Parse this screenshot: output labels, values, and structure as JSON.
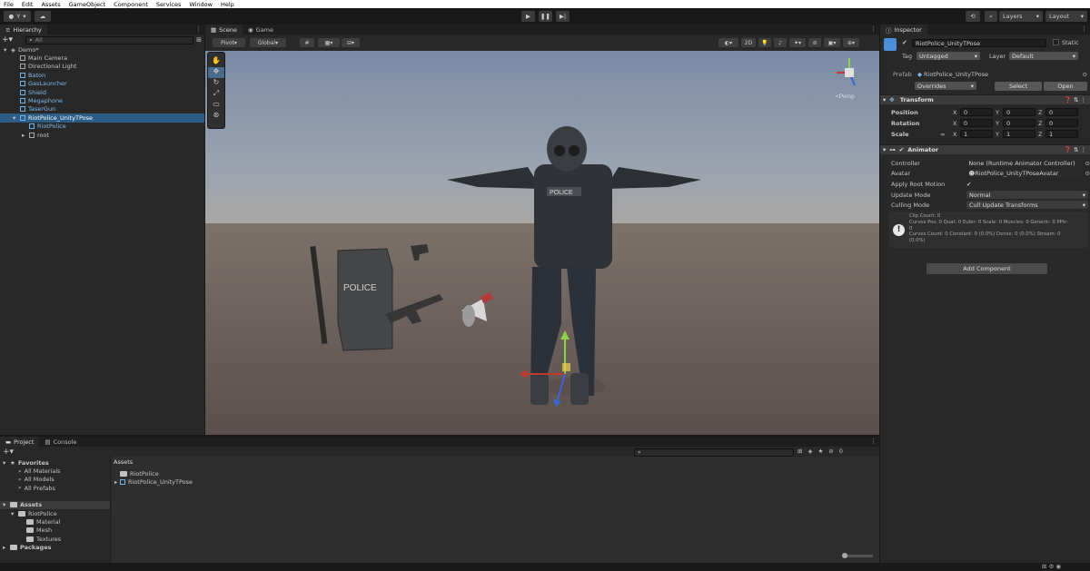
{
  "menu": [
    "File",
    "Edit",
    "Assets",
    "GameObject",
    "Component",
    "Services",
    "Window",
    "Help"
  ],
  "toolbar": {
    "account": "Y",
    "layers": "Layers",
    "layout": "Layout"
  },
  "hierarchy": {
    "tab": "Hierarchy",
    "search_placeholder": "All",
    "items": [
      {
        "label": "Demo*",
        "depth": 0,
        "kind": "scene"
      },
      {
        "label": "Main Camera",
        "depth": 1,
        "kind": "go"
      },
      {
        "label": "Directional Light",
        "depth": 1,
        "kind": "go"
      },
      {
        "label": "Baton",
        "depth": 1,
        "kind": "prefab"
      },
      {
        "label": "GasLauncher",
        "depth": 1,
        "kind": "prefab"
      },
      {
        "label": "Shield",
        "depth": 1,
        "kind": "prefab"
      },
      {
        "label": "Megaphone",
        "depth": 1,
        "kind": "prefab"
      },
      {
        "label": "TaserGun",
        "depth": 1,
        "kind": "prefab"
      },
      {
        "label": "RiotPolice_UnityTPose",
        "depth": 1,
        "kind": "prefab",
        "selected": true
      },
      {
        "label": "RiotPolice",
        "depth": 2,
        "kind": "prefab"
      },
      {
        "label": "root",
        "depth": 2,
        "kind": "go"
      }
    ]
  },
  "scene": {
    "tab_scene": "Scene",
    "tab_game": "Game",
    "pivot": "Pivot",
    "global": "Global",
    "mode2d": "2D",
    "persp": "<Persp"
  },
  "inspector": {
    "tab": "Inspector",
    "object_name": "RiotPolice_UnityTPose",
    "static_label": "Static",
    "tag_label": "Tag",
    "tag_value": "Untagged",
    "layer_label": "Layer",
    "layer_value": "Default",
    "prefab_label": "Prefab",
    "prefab_value": "RiotPolice_UnityTPose",
    "overrides": "Overrides",
    "select": "Select",
    "open": "Open",
    "transform": {
      "title": "Transform",
      "rows": [
        {
          "label": "Position",
          "x": "0",
          "y": "0",
          "z": "0"
        },
        {
          "label": "Rotation",
          "x": "0",
          "y": "0",
          "z": "0"
        },
        {
          "label": "Scale",
          "x": "1",
          "y": "1",
          "z": "1"
        }
      ]
    },
    "animator": {
      "title": "Animator",
      "controller_label": "Controller",
      "controller_value": "None (Runtime Animator Controller)",
      "avatar_label": "Avatar",
      "avatar_value": "RiotPolice_UnityTPoseAvatar",
      "root_motion_label": "Apply Root Motion",
      "update_label": "Update Mode",
      "update_value": "Normal",
      "culling_label": "Culling Mode",
      "culling_value": "Cull Update Transforms",
      "info": [
        "Clip Count: 0",
        "Curves Pos: 0 Quat: 0 Euler: 0 Scale: 0 Muscles: 0 Generic: 0 PPtr:",
        "0",
        "Curves Count: 0 Constant: 0 (0.0%) Dense: 0 (0.0%) Stream: 0",
        "(0.0%)"
      ]
    },
    "add_component": "Add Component"
  },
  "project": {
    "tab_project": "Project",
    "tab_console": "Console",
    "tree": [
      {
        "label": "Favorites",
        "depth": 0,
        "kind": "star"
      },
      {
        "label": "All Materials",
        "depth": 1,
        "kind": "search"
      },
      {
        "label": "All Models",
        "depth": 1,
        "kind": "search"
      },
      {
        "label": "All Prefabs",
        "depth": 1,
        "kind": "search"
      },
      {
        "label": "Assets",
        "depth": 0,
        "kind": "folder",
        "selected": true
      },
      {
        "label": "RiotPolice",
        "depth": 1,
        "kind": "folder"
      },
      {
        "label": "Material",
        "depth": 2,
        "kind": "folder"
      },
      {
        "label": "Mesh",
        "depth": 2,
        "kind": "folder"
      },
      {
        "label": "Textures",
        "depth": 2,
        "kind": "folder"
      },
      {
        "label": "Packages",
        "depth": 0,
        "kind": "folder"
      }
    ],
    "breadcrumb": "Assets",
    "assets": [
      {
        "label": "RiotPolice",
        "kind": "folder"
      },
      {
        "label": "RiotPolice_UnityTPose",
        "kind": "prefab"
      }
    ],
    "hidden_count": "0"
  },
  "scene_props": {
    "shield_text": "POLICE",
    "vest_text": "POLICE"
  }
}
